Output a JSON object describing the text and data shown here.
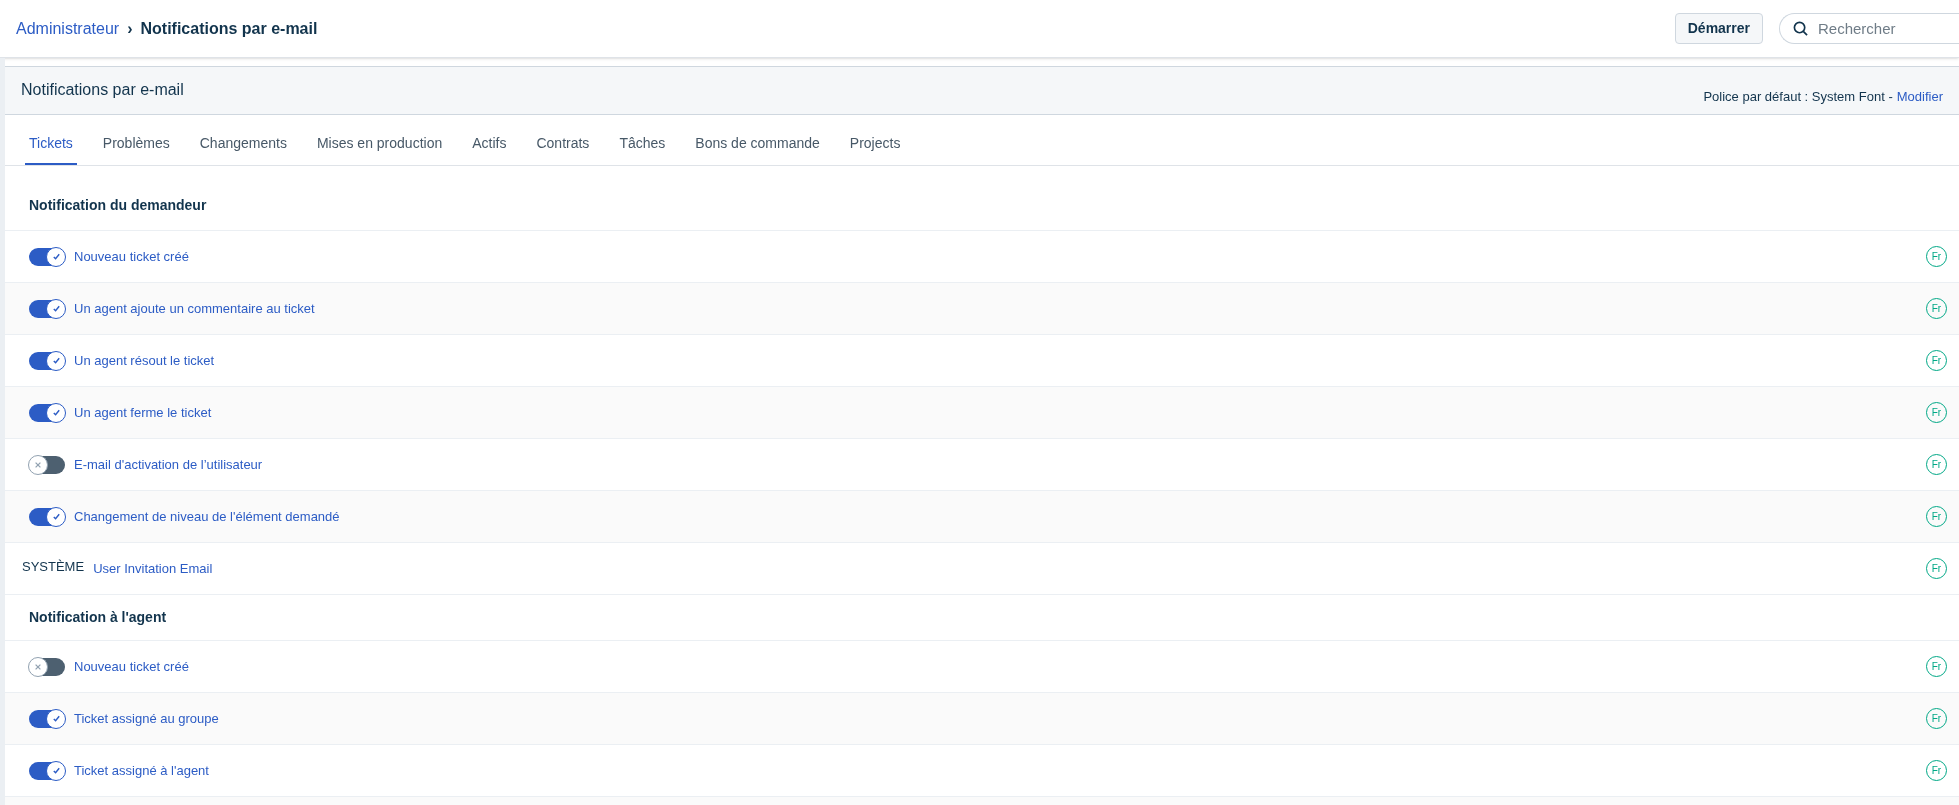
{
  "breadcrumb": {
    "parent": "Administrateur",
    "separator": "›",
    "current": "Notifications par e-mail"
  },
  "header_actions": {
    "start_button": "Démarrer",
    "search": {
      "placeholder": "Rechercher"
    }
  },
  "panel": {
    "title": "Notifications par e-mail",
    "font_note": "Police par défaut : System Font -",
    "font_link": "Modifier"
  },
  "tabs": [
    {
      "label": "Tickets",
      "selected": true
    },
    {
      "label": "Problèmes",
      "selected": false
    },
    {
      "label": "Changements",
      "selected": false
    },
    {
      "label": "Mises en production",
      "selected": false
    },
    {
      "label": "Actifs",
      "selected": false
    },
    {
      "label": "Contrats",
      "selected": false
    },
    {
      "label": "Tâches",
      "selected": false
    },
    {
      "label": "Bons de commande",
      "selected": false
    },
    {
      "label": "Projects",
      "selected": false
    }
  ],
  "sections": [
    {
      "title": "Notification du demandeur",
      "rows": [
        {
          "kind": "toggle",
          "on": true,
          "label": "Nouveau ticket créé",
          "language": "Fr"
        },
        {
          "kind": "toggle",
          "on": true,
          "label": "Un agent ajoute un commentaire au ticket",
          "language": "Fr"
        },
        {
          "kind": "toggle",
          "on": true,
          "label": "Un agent résout le ticket",
          "language": "Fr"
        },
        {
          "kind": "toggle",
          "on": true,
          "label": "Un agent ferme le ticket",
          "language": "Fr"
        },
        {
          "kind": "toggle",
          "on": false,
          "label": "E-mail d'activation de l’utilisateur",
          "language": "Fr"
        },
        {
          "kind": "toggle",
          "on": true,
          "label": "Changement de niveau de l'élément demandé",
          "language": "Fr"
        },
        {
          "kind": "system",
          "tag": "SYSTÈME",
          "label": "User Invitation Email",
          "language": "Fr"
        }
      ]
    },
    {
      "title": "Notification à l'agent",
      "rows": [
        {
          "kind": "toggle",
          "on": false,
          "label": "Nouveau ticket créé",
          "language": "Fr"
        },
        {
          "kind": "toggle",
          "on": true,
          "label": "Ticket assigné au groupe",
          "language": "Fr"
        },
        {
          "kind": "toggle",
          "on": true,
          "label": "Ticket assigné à l'agent",
          "language": "Fr"
        }
      ]
    }
  ]
}
